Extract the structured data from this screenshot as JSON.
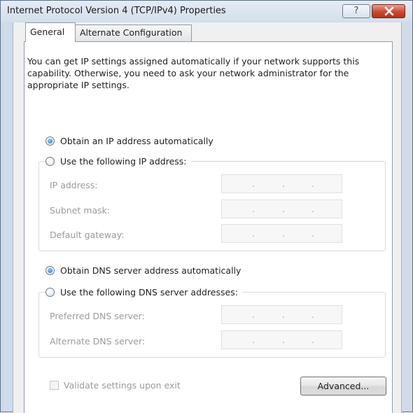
{
  "window": {
    "title": "Internet Protocol Version 4 (TCP/IPv4) Properties",
    "help_glyph": "?",
    "close_icon": "close-icon"
  },
  "tabs": [
    {
      "label": "General",
      "selected": true
    },
    {
      "label": "Alternate Configuration",
      "selected": false
    }
  ],
  "description": "You can get IP settings assigned automatically if your network supports this capability. Otherwise, you need to ask your network administrator for the appropriate IP settings.",
  "ip": {
    "auto_label": "Obtain an IP address automatically",
    "auto_selected": true,
    "manual_label": "Use the following IP address:",
    "fields": [
      {
        "label": "IP address:",
        "value": " .  .  . "
      },
      {
        "label": "Subnet mask:",
        "value": " .  .  . "
      },
      {
        "label": "Default gateway:",
        "value": " .  .  . "
      }
    ]
  },
  "dns": {
    "auto_label": "Obtain DNS server address automatically",
    "auto_selected": true,
    "manual_label": "Use the following DNS server addresses:",
    "fields": [
      {
        "label": "Preferred DNS server:",
        "value": " .  .  . "
      },
      {
        "label": "Alternate DNS server:",
        "value": " .  .  . "
      }
    ]
  },
  "validate_label": "Validate settings upon exit",
  "validate_checked": false,
  "advanced_label": "Advanced...",
  "colors": {
    "title_bar": "#d3dfec",
    "close_button": "#c74a33",
    "radio_selected": "#1b6cc7"
  }
}
